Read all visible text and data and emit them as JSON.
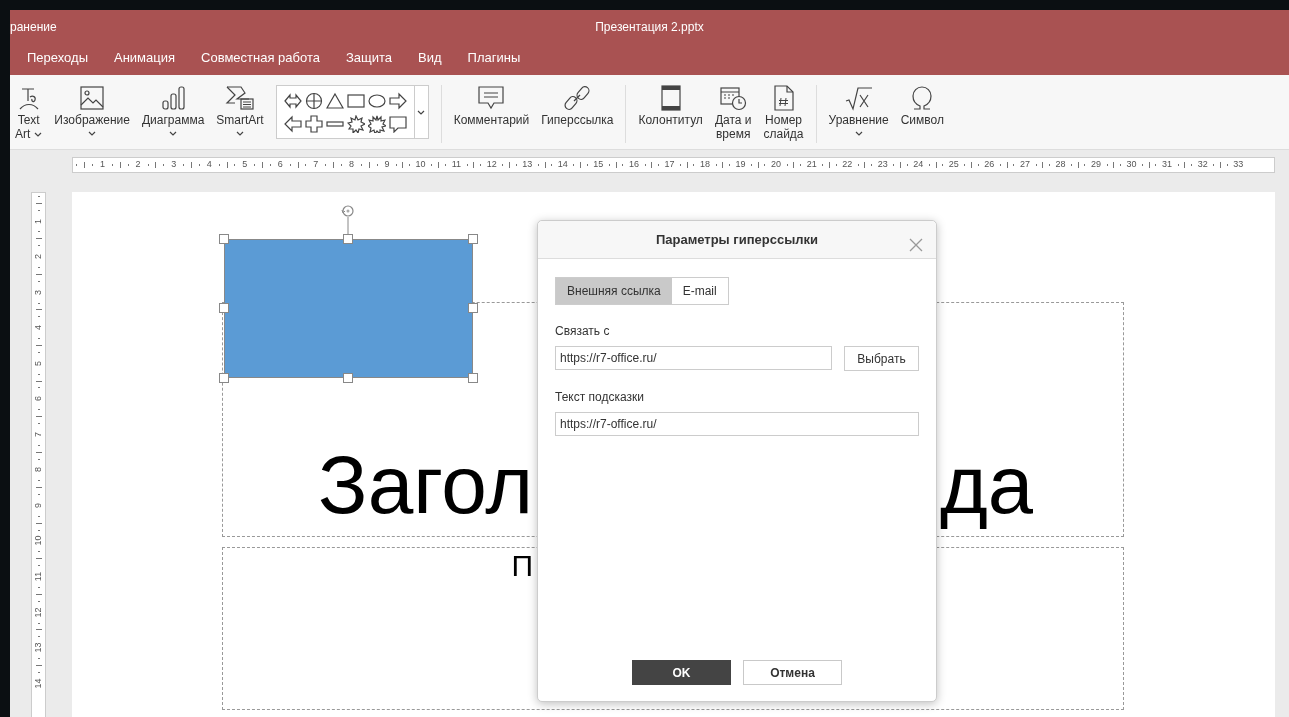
{
  "window": {
    "title_fragment": "ранение",
    "title": "Презентация 2.pptx"
  },
  "menu_tabs": [
    "Переходы",
    "Анимация",
    "Совместная работа",
    "Защита",
    "Вид",
    "Плагины"
  ],
  "toolbar": {
    "groups": [
      [
        {
          "kind": "button",
          "lines": [
            "Text",
            "Art"
          ],
          "dropdown": true
        },
        {
          "kind": "button",
          "lines": [
            "Изображение"
          ],
          "dropdown": true
        },
        {
          "kind": "button",
          "lines": [
            "Диаграмма"
          ],
          "dropdown": true
        },
        {
          "kind": "button",
          "lines": [
            "SmartArt"
          ],
          "dropdown": true
        },
        {
          "kind": "gallery",
          "dropdown": true
        }
      ],
      [
        {
          "kind": "button",
          "lines": [
            "Комментарий"
          ],
          "dropdown": false
        },
        {
          "kind": "button",
          "lines": [
            "Гиперссылка"
          ],
          "dropdown": false
        }
      ],
      [
        {
          "kind": "button",
          "lines": [
            "Колонтитул"
          ],
          "dropdown": false
        },
        {
          "kind": "button",
          "lines": [
            "Дата и",
            "время"
          ],
          "dropdown": false
        },
        {
          "kind": "button",
          "lines": [
            "Номер",
            "слайда"
          ],
          "dropdown": false
        }
      ],
      [
        {
          "kind": "button",
          "lines": [
            "Уравнение"
          ],
          "dropdown": true
        },
        {
          "kind": "button",
          "lines": [
            "Символ"
          ],
          "dropdown": false
        }
      ]
    ]
  },
  "ruler_h": [
    "1",
    "2",
    "3",
    "4",
    "5",
    "6",
    "7",
    "8",
    "9",
    "10",
    "11",
    "12",
    "13",
    "14",
    "15",
    "16",
    "17",
    "18",
    "19",
    "20",
    "21",
    "22",
    "23",
    "24",
    "25",
    "26",
    "27",
    "28",
    "29",
    "30",
    "31",
    "32",
    "33"
  ],
  "ruler_v": [
    "1",
    "2",
    "3",
    "4",
    "5",
    "6",
    "7",
    "8",
    "9",
    "10",
    "11",
    "12",
    "13",
    "14"
  ],
  "slide": {
    "title_fragments": [
      "Загол",
      "да"
    ],
    "subtitle_fragment": "П"
  },
  "dialog": {
    "title": "Параметры гиперссылки",
    "tabs": [
      {
        "label": "Внешняя ссылка",
        "selected": true
      },
      {
        "label": "E-mail",
        "selected": false
      }
    ],
    "fields": [
      {
        "label": "Связать с",
        "value": "https://r7-office.ru/",
        "button": "Выбрать"
      },
      {
        "label": "Текст подсказки",
        "value": "https://r7-office.ru/"
      }
    ],
    "buttons": [
      {
        "label": "OK",
        "kind": "primary"
      },
      {
        "label": "Отмена",
        "kind": "secondary"
      }
    ]
  }
}
